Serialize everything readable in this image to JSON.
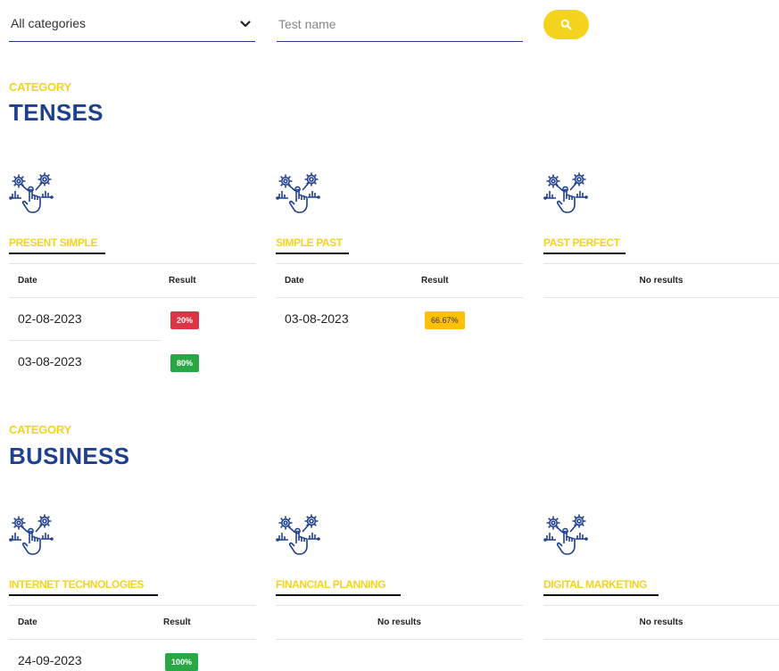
{
  "filters": {
    "category_select": "All categories",
    "search_placeholder": "Test name",
    "search_icon": "magnifier-icon"
  },
  "colors": {
    "accent_yellow": "#f4d31f",
    "brand_blue": "#1f3f8f",
    "badge_red": "#dc3545",
    "badge_green": "#28a745",
    "badge_yellow": "#ffc107"
  },
  "table_labels": {
    "date": "Date",
    "result": "Result",
    "no_results": "No results"
  },
  "categories": [
    {
      "eyebrow": "CATEGORY",
      "name": "TENSES",
      "tests": [
        {
          "name": "PRESENT SIMPLE",
          "icon": "gears-hand-icon",
          "results": [
            {
              "date": "02-08-2023",
              "score": "20%",
              "status": "red"
            },
            {
              "date": "03-08-2023",
              "score": "80%",
              "status": "green"
            }
          ]
        },
        {
          "name": "SIMPLE PAST",
          "icon": "gears-hand-icon",
          "results": [
            {
              "date": "03-08-2023",
              "score": "66.67%",
              "status": "yellow"
            }
          ]
        },
        {
          "name": "PAST PERFECT",
          "icon": "gears-hand-icon",
          "results": []
        }
      ]
    },
    {
      "eyebrow": "CATEGORY",
      "name": "BUSINESS",
      "tests": [
        {
          "name": "INTERNET TECHNOLOGIES",
          "icon": "gears-hand-icon",
          "results": [
            {
              "date": "24-09-2023",
              "score": "100%",
              "status": "green"
            }
          ]
        },
        {
          "name": "FINANCIAL PLANNING",
          "icon": "gears-hand-icon",
          "results": []
        },
        {
          "name": "DIGITAL MARKETING",
          "icon": "gears-hand-icon",
          "results": []
        }
      ]
    }
  ]
}
